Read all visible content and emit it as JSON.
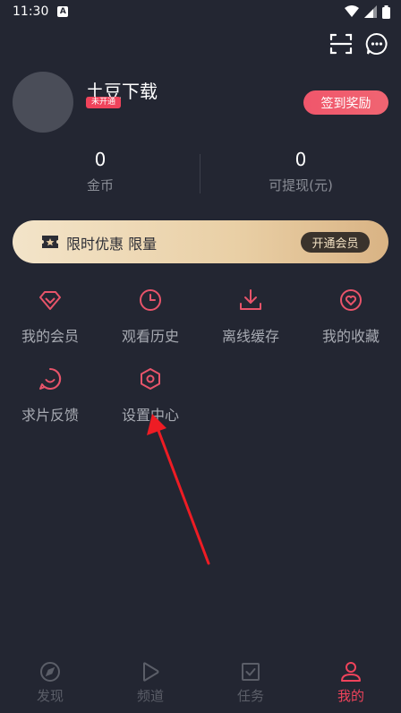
{
  "status_bar": {
    "time": "11:30",
    "notif": "A"
  },
  "profile": {
    "username": "土豆下载",
    "vip_status": "未开通",
    "checkin_label": "签到奖励"
  },
  "stats": [
    {
      "value": "0",
      "label": "金币"
    },
    {
      "value": "0",
      "label": "可提现(元)"
    }
  ],
  "vip_banner": {
    "text": "限时优惠 限量",
    "button": "开通会员"
  },
  "menu": [
    {
      "label": "我的会员",
      "icon": "gem-icon"
    },
    {
      "label": "观看历史",
      "icon": "clock-icon"
    },
    {
      "label": "离线缓存",
      "icon": "download-icon"
    },
    {
      "label": "我的收藏",
      "icon": "heart-icon"
    },
    {
      "label": "求片反馈",
      "icon": "feedback-icon"
    },
    {
      "label": "设置中心",
      "icon": "settings-hex-icon"
    }
  ],
  "tabs": [
    {
      "label": "发现",
      "icon": "compass-icon",
      "active": false
    },
    {
      "label": "频道",
      "icon": "play-icon",
      "active": false
    },
    {
      "label": "任务",
      "icon": "task-icon",
      "active": false
    },
    {
      "label": "我的",
      "icon": "user-icon",
      "active": true
    }
  ],
  "colors": {
    "background": "#232632",
    "accent": "#f0435b",
    "icon_accent": "#e8546a",
    "muted_text": "#8a8d96"
  }
}
